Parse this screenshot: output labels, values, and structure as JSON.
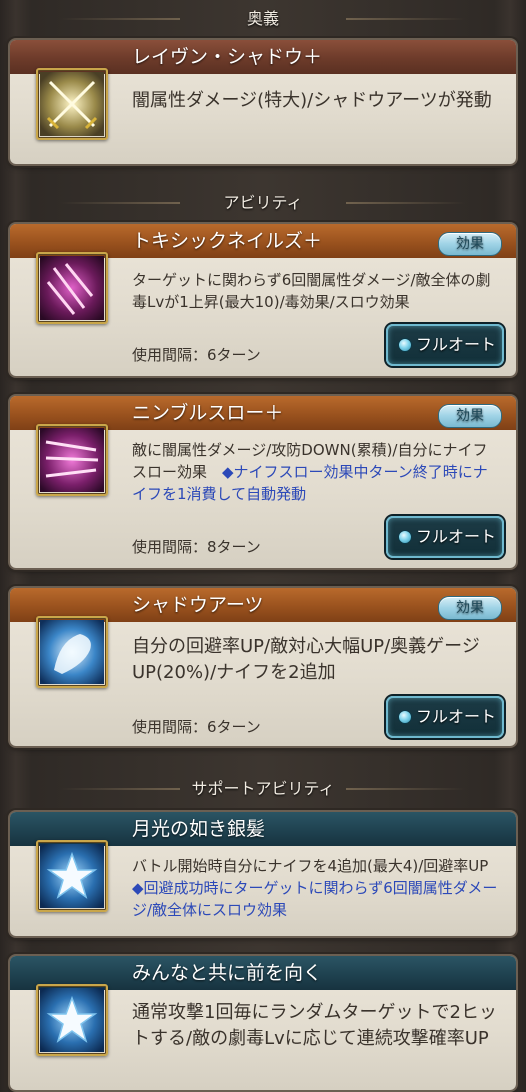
{
  "sections": {
    "ougi": "奥義",
    "ability": "アビリティ",
    "support": "サポートアビリティ"
  },
  "ougi": {
    "name": "レイヴン・シャドウ＋",
    "desc": "闇属性ダメージ(特大)/シャドウアーツが発動"
  },
  "abilities": [
    {
      "name": "トキシックネイルズ＋",
      "effect_label": "効果",
      "desc": "ターゲットに関わらず6回闇属性ダメージ/敵全体の劇毒Lvが1上昇(最大10)/毒効果/スロウ効果",
      "desc_note": "",
      "interval": "使用間隔：6ターン",
      "auto_label": "フルオート"
    },
    {
      "name": "ニンブルスロー＋",
      "effect_label": "効果",
      "desc": "敵に闇属性ダメージ/攻防DOWN(累積)/自分にナイフスロー効果　",
      "desc_note": "◆ナイフスロー効果中ターン終了時にナイフを1消費して自動発動",
      "interval": "使用間隔：8ターン",
      "auto_label": "フルオート"
    },
    {
      "name": "シャドウアーツ",
      "effect_label": "効果",
      "desc": "自分の回避率UP/敵対心大幅UP/奥義ゲージUP(20%)/ナイフを2追加",
      "desc_note": "",
      "interval": "使用間隔：6ターン",
      "auto_label": "フルオート"
    }
  ],
  "supports": [
    {
      "name": "月光の如き銀髪",
      "desc": "バトル開始時自分にナイフを4追加(最大4)/回避率UP　",
      "desc_note": "◆回避成功時にターゲットに関わらず6回闇属性ダメージ/敵全体にスロウ効果"
    },
    {
      "name": "みんなと共に前を向く",
      "desc": "通常攻撃1回毎にランダムターゲットで2ヒットする/敵の劇毒Lvに応じて連続攻撃確率UP",
      "desc_note": ""
    }
  ],
  "colors": {
    "title_brown": "#6d3b2a",
    "title_orange": "#9a521e",
    "title_teal": "#1f4250",
    "note_blue": "#2c49b8",
    "body_text": "#3a332c"
  },
  "icons": [
    "crossed-swords-icon",
    "toxic-nails-icon",
    "nimble-throw-icon",
    "shadow-arts-icon",
    "star-icon",
    "star-icon"
  ]
}
